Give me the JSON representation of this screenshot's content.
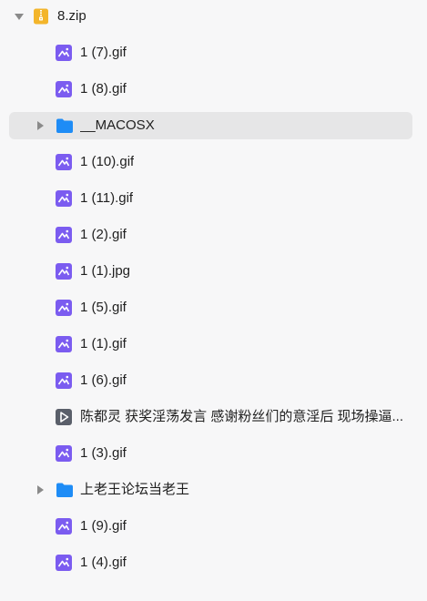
{
  "tree": {
    "root": {
      "name": "8.zip",
      "icon": "zip-archive-icon",
      "expanded": true
    },
    "items": [
      {
        "type": "image",
        "name": "1 (7).gif",
        "icon": "image-file-icon"
      },
      {
        "type": "image",
        "name": "1 (8).gif",
        "icon": "image-file-icon"
      },
      {
        "type": "folder",
        "name": "__MACOSX",
        "icon": "folder-icon",
        "expanded": false,
        "selected": true
      },
      {
        "type": "image",
        "name": "1 (10).gif",
        "icon": "image-file-icon"
      },
      {
        "type": "image",
        "name": "1 (11).gif",
        "icon": "image-file-icon"
      },
      {
        "type": "image",
        "name": "1 (2).gif",
        "icon": "image-file-icon"
      },
      {
        "type": "image",
        "name": "1 (1).jpg",
        "icon": "image-file-icon"
      },
      {
        "type": "image",
        "name": "1 (5).gif",
        "icon": "image-file-icon"
      },
      {
        "type": "image",
        "name": "1 (1).gif",
        "icon": "image-file-icon"
      },
      {
        "type": "image",
        "name": "1 (6).gif",
        "icon": "image-file-icon"
      },
      {
        "type": "video",
        "name": "陈都灵 获奖淫荡发言 感谢粉丝们的意淫后 现场操逼...",
        "icon": "video-file-icon"
      },
      {
        "type": "image",
        "name": "1 (3).gif",
        "icon": "image-file-icon"
      },
      {
        "type": "folder",
        "name": "上老王论坛当老王",
        "icon": "folder-icon",
        "expanded": false
      },
      {
        "type": "image",
        "name": "1 (9).gif",
        "icon": "image-file-icon"
      },
      {
        "type": "image",
        "name": "1 (4).gif",
        "icon": "image-file-icon"
      }
    ]
  },
  "colors": {
    "background": "#f7f7f8",
    "selected_row": "#e6e6e7",
    "image_icon": "#7b5cf0",
    "folder_icon": "#1e8cf6",
    "zip_icon": "#f3b52b",
    "video_icon": "#5a5f6a",
    "caret": "#8a8a8a"
  }
}
